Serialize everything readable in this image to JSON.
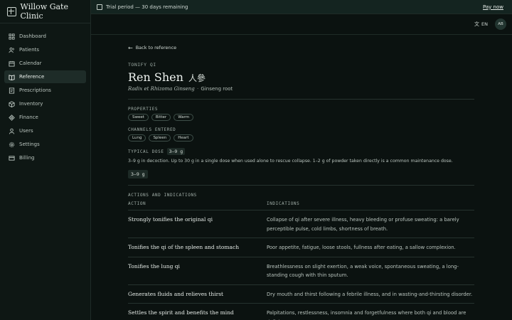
{
  "app": {
    "name": "Willow Gate Clinic"
  },
  "sidebar": {
    "items": [
      {
        "label": "Dashboard",
        "icon": "grid-icon",
        "active": false
      },
      {
        "label": "Patients",
        "icon": "users-icon",
        "active": false
      },
      {
        "label": "Calendar",
        "icon": "calendar-icon",
        "active": false
      },
      {
        "label": "Reference",
        "icon": "book-icon",
        "active": true
      },
      {
        "label": "Prescriptions",
        "icon": "prescription-icon",
        "active": false
      },
      {
        "label": "Inventory",
        "icon": "box-icon",
        "active": false
      },
      {
        "label": "Finance",
        "icon": "finance-icon",
        "active": false
      },
      {
        "label": "Users",
        "icon": "user-icon",
        "active": false
      },
      {
        "label": "Settings",
        "icon": "gear-icon",
        "active": false
      },
      {
        "label": "Billing",
        "icon": "card-icon",
        "active": false
      }
    ]
  },
  "topbar": {
    "trial_text": "Trial period — 30 days remaining",
    "pay_label": "Pay now"
  },
  "header": {
    "lang": "EN",
    "avatar": "AB"
  },
  "herb": {
    "back_label": "Back to reference",
    "category": "TONIFY QI",
    "name": "Ren Shen",
    "name_cjk": "人參",
    "latin": "Radix et Rhizoma Ginseng",
    "separator": "·",
    "common": "Ginseng root",
    "properties_label": "PROPERTIES",
    "properties": [
      "Sweet",
      "Bitter",
      "Warm"
    ],
    "channels_label": "CHANNELS ENTERED",
    "channels": [
      "Lung",
      "Spleen",
      "Heart"
    ],
    "dose_label": "TYPICAL DOSE",
    "dose": "3–9 g",
    "dose_text": "3–9 g in decoction. Up to 30 g in a single dose when used alone to rescue collapse. 1–2 g of powder taken directly is a common maintenance dose.",
    "dose_badge": "3–9 g"
  },
  "actions": {
    "section_label": "ACTIONS AND INDICATIONS",
    "col_action": "ACTION",
    "col_indications": "INDICATIONS",
    "rows": [
      {
        "action": "Strongly tonifies the original qi",
        "indications": "Collapse of qi after severe illness, heavy bleeding or profuse sweating: a barely perceptible pulse, cold limbs, shortness of breath."
      },
      {
        "action": "Tonifies the qi of the spleen and stomach",
        "indications": "Poor appetite, fatigue, loose stools, fullness after eating, a sallow complexion."
      },
      {
        "action": "Tonifies the lung qi",
        "indications": "Breathlessness on slight exertion, a weak voice, spontaneous sweating, a long-standing cough with thin sputum."
      },
      {
        "action": "Generates fluids and relieves thirst",
        "indications": "Dry mouth and thirst following a febrile illness, and in wasting-and-thirsting disorder."
      },
      {
        "action": "Settles the spirit and benefits the mind",
        "indications": "Palpitations, restlessness, insomnia and forgetfulness where both qi and blood are deficient."
      }
    ]
  }
}
